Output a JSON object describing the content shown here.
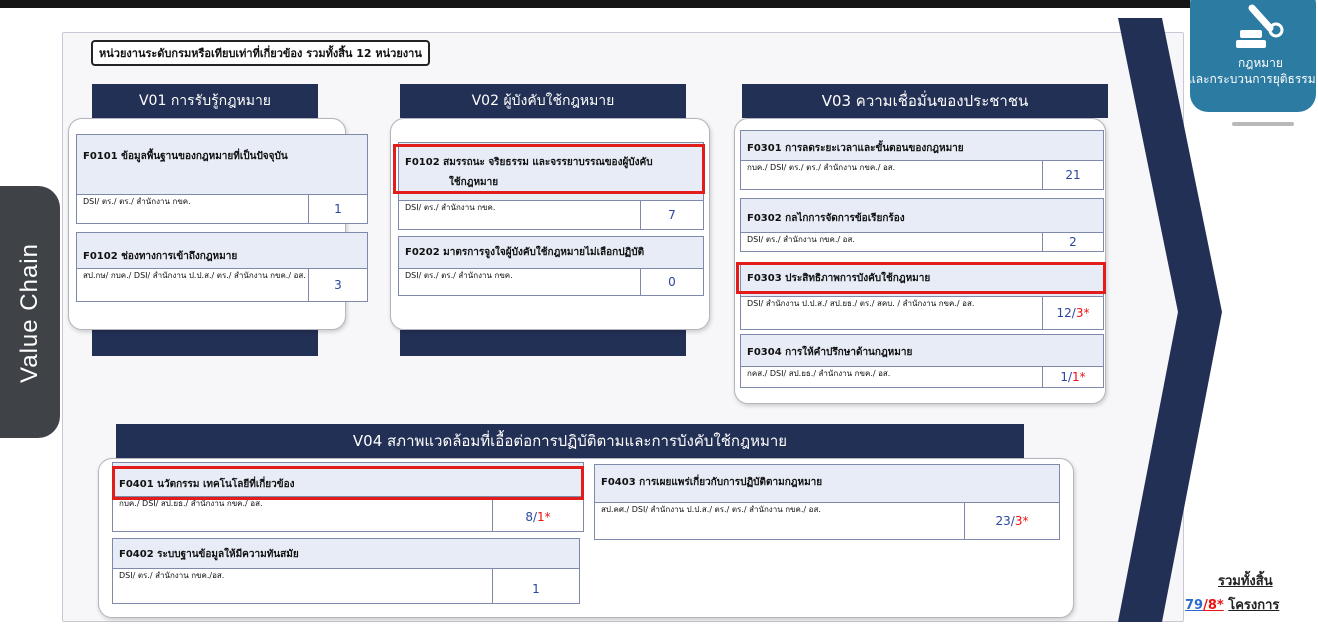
{
  "side_label": "Value Chain",
  "units_note": "หน่วยงานระดับกรมหรือเทียบเท่าที่เกี่ยวข้อง รวมทั้งสิ้น 12 หน่วยงาน",
  "badge": {
    "line1": "กฎหมาย",
    "line2": "และกระบวนการยุติธรรม",
    "icon": "gavel-icon"
  },
  "total": {
    "label": "รวมทั้งสิ้น",
    "projects": "79",
    "slash": "/",
    "star": "8*",
    "unit": "โครงการ"
  },
  "colors": {
    "header_navy": "#233055",
    "card_fill": "#e7ecf6",
    "highlight_red": "#e21b1b",
    "count_blue": "#2a46a0",
    "badge_blue": "#2b7ba3"
  },
  "v01": {
    "title": "V01 การรับรู้กฎหมาย",
    "cards": [
      {
        "title": "F0101  ข้อมูลพื้นฐานของกฎหมายที่เป็นปัจจุบัน",
        "agency": "DSI/ ตร./ ตร./ สำนักงาน กขค.",
        "count": "1"
      },
      {
        "title": "F0102  ช่องทางการเข้าถึงกฎหมาย",
        "agency": "สป.กษ/ กบค./ DSI/ สำนักงาน ป.ป.ส./ ตร./ สำนักงาน กขค./ อส.",
        "count": "3"
      }
    ]
  },
  "v02": {
    "title": "V02 ผู้บังคับใช้กฎหมาย",
    "cards": [
      {
        "title": "F0102  สมรรถนะ จริยธรรม และจรรยาบรรณของผู้บังคับ",
        "title2": "ใช้กฎหมาย",
        "agency": "DSI/ ตร./ สำนักงาน กขค.",
        "count": "7"
      },
      {
        "title": "F0202  มาตรการจูงใจผู้บังคับใช้กฎหมายไม่เลือกปฏิบัติ",
        "agency": "DSI/ ตร./ ตร./ สำนักงาน กขค.",
        "count": "0"
      }
    ]
  },
  "v03": {
    "title": "V03 ความเชื่อมั่นของประชาชน",
    "cards": [
      {
        "title": "F0301  การลดระยะเวลาและขั้นตอนของกฎหมาย",
        "agency": "กบค./ DSI/ ตร./ ตร./ สำนักงาน กขค./ อส.",
        "count": "21"
      },
      {
        "title": "F0302  กลไกการจัดการข้อเรียกร้อง",
        "agency": "DSI/ ตร./ สำนักงาน กขค./ อส.",
        "count": "2"
      },
      {
        "title": "F0303  ประสิทธิภาพการบังคับใช้กฎหมาย",
        "agency": "DSI/ สำนักงาน ป.ป.ส./ สป.ยธ./ ตร./ สคบ. / สำนักงาน กขค./ อส.",
        "count": "12",
        "star": "3*"
      },
      {
        "title": "F0304  การให้คำปรึกษาด้านกฎหมาย",
        "agency": "กคส./ DSI/ สป.ยธ./ สำนักงาน กขค./ อส.",
        "count": "1",
        "star": "1*"
      }
    ]
  },
  "v04": {
    "title": "V04 สภาพแวดล้อมที่เอื้อต่อการปฏิบัติตามและการบังคับใช้กฎหมาย",
    "cards": [
      {
        "title": "F0401  นวัตกรรม เทคโนโลยีที่เกี่ยวข้อง",
        "agency": "กบค./ DSI/ สป.ยธ./ สำนักงาน กขค./ อส.",
        "count": "8",
        "star": "1*"
      },
      {
        "title": "F0402  ระบบฐานข้อมูลให้มีความทันสมัย",
        "agency": "DSI/ ตร./ สำนักงาน กขค./อส.",
        "count": "1"
      },
      {
        "title": "F0403  การเผยแพร่เกี่ยวกับการปฏิบัติตามกฎหมาย",
        "agency": "สป.คศ./ DSI/ สำนักงาน ป.ป.ส./ ตร./ ตร./ สำนักงาน กขค./ อส.",
        "count": "23",
        "star": "3*"
      }
    ]
  }
}
